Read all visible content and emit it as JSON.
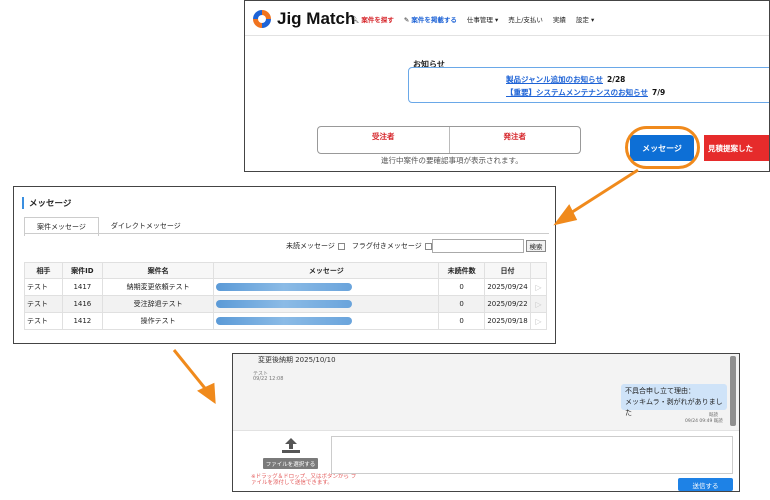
{
  "colors": {
    "brand_orange": "#f0731f",
    "brand_blue": "#1e63d6",
    "accent_red": "#d6262b",
    "button_blue": "#0d6fd6",
    "highlight_orange": "#f08a1c"
  },
  "header": {
    "app_name": "Jig Match",
    "nav": {
      "find": "案件を探す",
      "post": "案件を掲載する",
      "work": "仕事管理",
      "sales": "売上/支払い",
      "results": "実績",
      "settings": "設定"
    }
  },
  "notices": {
    "title": "お知らせ",
    "items": [
      {
        "link": "製品ジャンル追加のお知らせ",
        "date": "2/28"
      },
      {
        "link": "【重要】システムメンテナンスのお知らせ",
        "date": "7/9"
      }
    ]
  },
  "roles": {
    "receiver": "受注者",
    "orderer": "発注者",
    "note": "進行中案件の要確認事項が表示されます。"
  },
  "buttons": {
    "message": "メッセージ",
    "estimate": "見積提案した"
  },
  "messages": {
    "title": "メッセージ",
    "tabs": [
      "案件メッセージ",
      "ダイレクトメッセージ"
    ],
    "filter_unread": "未読メッセージ",
    "filter_flag": "フラグ付きメッセージ",
    "search_label": "検索",
    "columns": [
      "相手",
      "案件ID",
      "案件名",
      "メッセージ",
      "未読件数",
      "日付"
    ],
    "rows": [
      {
        "partner": "テスト",
        "id": "1417",
        "name": "納期変更依頼テスト",
        "unread": "0",
        "date": "2025/09/24"
      },
      {
        "partner": "テスト",
        "id": "1416",
        "name": "受注辞退テスト",
        "unread": "0",
        "date": "2025/09/22"
      },
      {
        "partner": "テスト",
        "id": "1412",
        "name": "操作テスト",
        "unread": "0",
        "date": "2025/09/18"
      }
    ]
  },
  "chat": {
    "top_line": "変更後納期 2025/10/10",
    "sender": "テスト",
    "sent_time": "09/22 12:08",
    "bubble_line1": "不具合申し立て理由：",
    "bubble_line2": "メッキムラ・剥がれがありました",
    "read_label": "既読",
    "read_time": "09/24 09:49 既読",
    "file_button": "ファイルを選択する",
    "drop_hint": "※ドラッグ＆ドロップ、又はボタンから ファイルを添付して送信できます。",
    "send_button": "送信する"
  }
}
